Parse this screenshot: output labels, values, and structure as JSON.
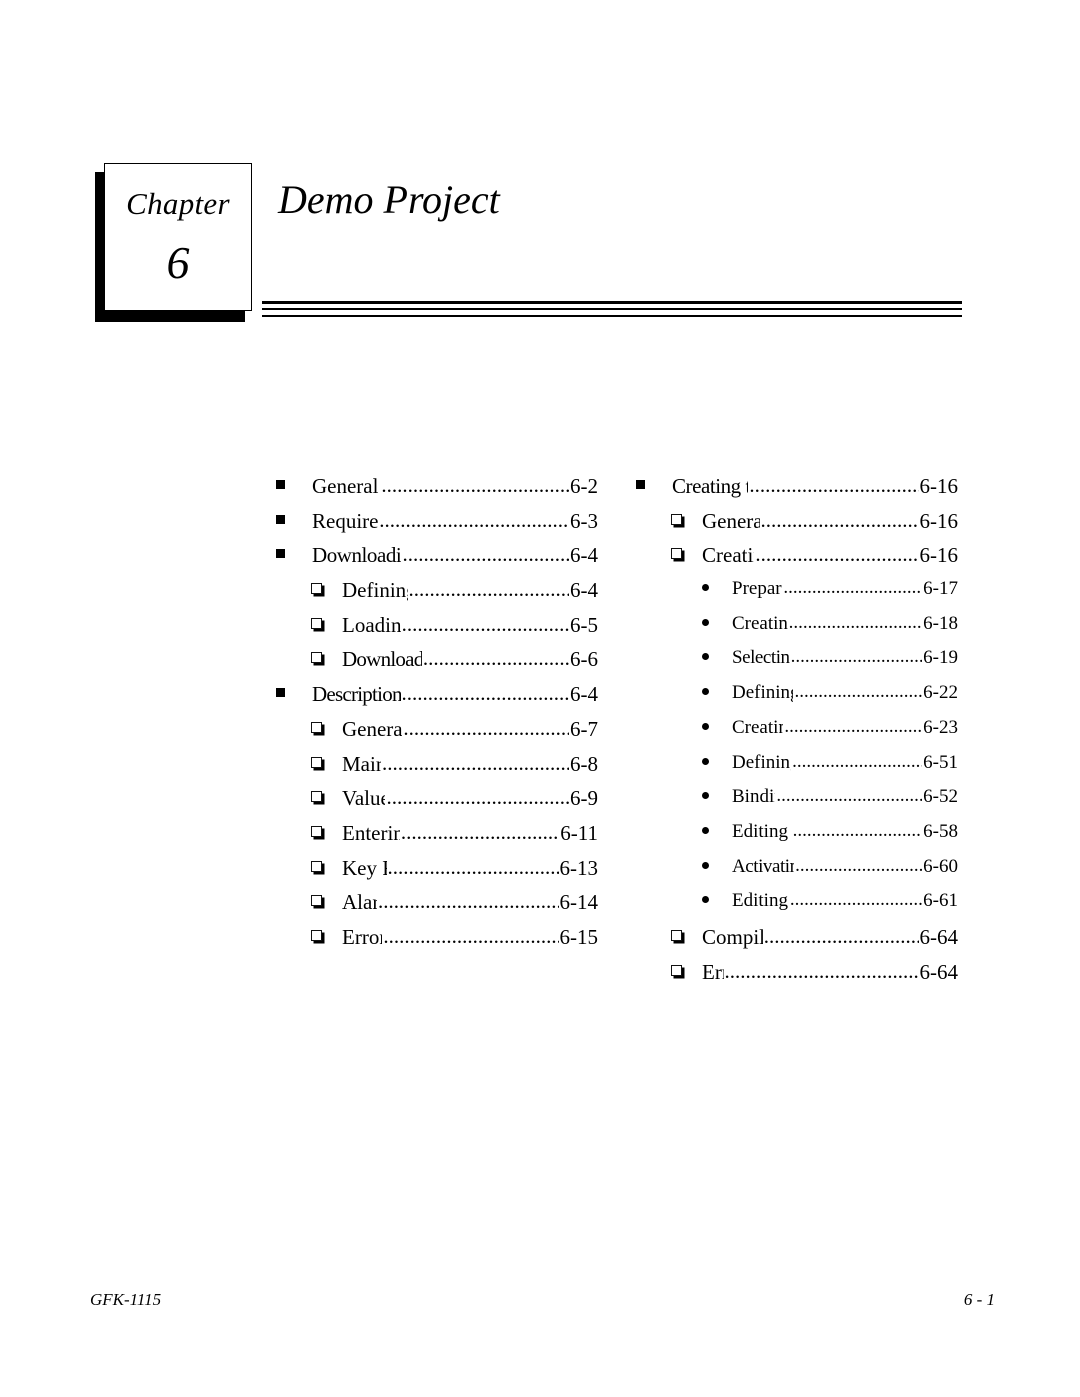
{
  "chapter": {
    "word": "Chapter",
    "number": "6",
    "title": "Demo Project"
  },
  "toc": {
    "left_column": [
      {
        "level": 1,
        "label": "General Information",
        "page": "6-2"
      },
      {
        "level": 1,
        "label": "Required Hardware",
        "page": "6-3"
      },
      {
        "level": 1,
        "label": "Downloading the Demo Project",
        "page": "6-4"
      },
      {
        "level": 2,
        "label": "Defining the User Path",
        "page": "6-4"
      },
      {
        "level": 2,
        "label": "Loading the Project",
        "page": "6-5"
      },
      {
        "level": 2,
        "label": "Downloading/Starting the Project",
        "page": "6-6"
      },
      {
        "level": 1,
        "label": "Description of the Demo Project",
        "page": "6-4"
      },
      {
        "level": 2,
        "label": "General Information",
        "page": "6-7"
      },
      {
        "level": 2,
        "label": "Main Menu",
        "page": "6-8"
      },
      {
        "level": 2,
        "label": "Value Entries",
        "page": "6-9"
      },
      {
        "level": 2,
        "label": "Entering a Password",
        "page": "6-11"
      },
      {
        "level": 2,
        "label": "Key Functions",
        "page": "6-13"
      },
      {
        "level": 2,
        "label": "Alarm List",
        "page": "6-14"
      },
      {
        "level": 2,
        "label": "Error Picture",
        "page": "6-15"
      }
    ],
    "right_column": [
      {
        "level": 1,
        "label": "Creating the Demo Project",
        "page": "6-16"
      },
      {
        "level": 2,
        "label": "General Information",
        "page": "6-16"
      },
      {
        "level": 2,
        "label": "Creating a Project",
        "page": "6-16"
      },
      {
        "level": 3,
        "label": "Preparing a Concept",
        "page": "6-17"
      },
      {
        "level": 3,
        "label": "Creating a New Project",
        "page": "6-18"
      },
      {
        "level": 3,
        "label": "Selecting the Connections",
        "page": "6-19"
      },
      {
        "level": 3,
        "label": "Defining Key Assignments",
        "page": "6-22"
      },
      {
        "level": 3,
        "label": "Creating the Pictures",
        "page": "6-23"
      },
      {
        "level": 3,
        "label": "Defining the Text Groups",
        "page": "6-51"
      },
      {
        "level": 3,
        "label": "Binding Pictures",
        "page": "6-52"
      },
      {
        "level": 3,
        "label": "Editing the Alarm System",
        "page": "6-58"
      },
      {
        "level": 3,
        "label": "Activating the Alarm System",
        "page": "6-60"
      },
      {
        "level": 3,
        "label": "Editing the Connections",
        "page": "6-61"
      },
      {
        "level": 2,
        "label": "Compiling the Project",
        "page": "6-64"
      },
      {
        "level": 2,
        "label": "Errors",
        "page": "6-64"
      }
    ]
  },
  "footer": {
    "document_id": "GFK-1115",
    "page_number": "6 - 1"
  }
}
